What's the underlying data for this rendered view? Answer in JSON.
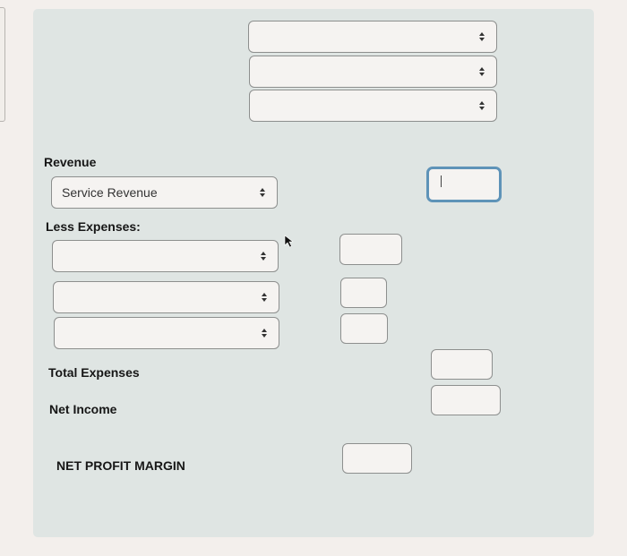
{
  "header_selects": [
    {
      "value": "",
      "icon": "up-down-arrows-icon"
    },
    {
      "value": "",
      "icon": "up-down-arrows-icon"
    },
    {
      "value": "",
      "icon": "up-down-arrows-icon"
    }
  ],
  "revenue": {
    "label": "Revenue",
    "select_value": "Service Revenue",
    "amount_value": ""
  },
  "expenses": {
    "label": "Less Expenses:",
    "rows": [
      {
        "select_value": "",
        "amount_value": ""
      },
      {
        "select_value": "",
        "amount_value": ""
      },
      {
        "select_value": "",
        "amount_value": ""
      }
    ]
  },
  "totals": {
    "total_expenses_label": "Total Expenses",
    "total_expenses_value": "",
    "net_income_label": "Net Income",
    "net_income_value": ""
  },
  "margin": {
    "label": "NET PROFIT MARGIN",
    "value": ""
  },
  "colors": {
    "panel_bg": "#dfe5e3",
    "focus_border": "#5e93b8"
  }
}
